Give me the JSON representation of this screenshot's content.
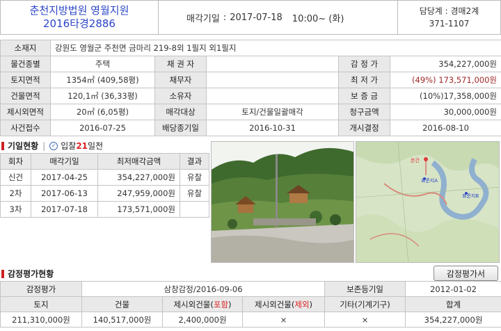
{
  "header": {
    "court": "춘천지방법원 영월지원",
    "case_no": "2016타경2886",
    "sale_date_label": "매각기일",
    "sale_date": "2017-07-18",
    "sale_time": "10:00~ (화)",
    "dept": "담당계 : 경매2계",
    "phone": "371-1107"
  },
  "property": {
    "address_label": "소재지",
    "address": "강원도 영월군 주천면 금마리 219-8외 1필지 외1필지",
    "type_label": "물건종별",
    "type": "주택",
    "creditor_label": "채 권 자",
    "creditor": "",
    "appraisal_label": "감 정 가",
    "appraisal": "354,227,000원",
    "land_label": "토지면적",
    "land": "1354㎡ (409,58평)",
    "debtor_label": "채무자",
    "debtor": "",
    "min_label": "최 저 가",
    "min_pct": "(49%)",
    "min_price": "173,571,000원",
    "bldg_label": "건물면적",
    "bldg": "120,1㎡ (36,33평)",
    "owner_label": "소유자",
    "owner": "",
    "deposit_label": "보 증 금",
    "deposit": "(10%)17,358,000원",
    "excl_label": "제시외면적",
    "excl": "20㎡ (6,05평)",
    "target_label": "매각대상",
    "target": "토지/건물일괄매각",
    "claim_label": "청구금액",
    "claim": "30,000,000원",
    "receipt_label": "사건접수",
    "receipt": "2016-07-25",
    "dist_label": "배당종기일",
    "dist": "2016-10-31",
    "start_label": "개시결정",
    "start": "2016-08-10"
  },
  "auction": {
    "title": "기일현황",
    "bid_prefix": "입찰",
    "bid_days": "21",
    "bid_suffix": "일전",
    "headers": [
      "회차",
      "매각기일",
      "최저매각금액",
      "결과"
    ],
    "rows": [
      {
        "round": "신건",
        "date": "2017-04-25",
        "price": "354,227,000원",
        "result": "유찰"
      },
      {
        "round": "2차",
        "date": "2017-06-13",
        "price": "247,959,000원",
        "result": "유찰"
      },
      {
        "round": "3차",
        "date": "2017-07-18",
        "price": "173,571,000원",
        "result": ""
      }
    ]
  },
  "map": {
    "label_main": "본건",
    "label_a": "표준지A",
    "label_b": "표준지B"
  },
  "appraisal": {
    "title": "감정평가현황",
    "button": "감정평가서",
    "agency_label": "감정평가",
    "agency": "삼창감정/2016-09-06",
    "preserve_label": "보존등기일",
    "preserve": "2012-01-02",
    "col_land": "토지",
    "col_bldg": "건물",
    "col_ex_in_a": "제시외건물(",
    "col_ex_in_b": "포함",
    "col_ex_out_a": "제시외건물(",
    "col_ex_out_b": "제외",
    "col_close": ")",
    "col_other": "기타(기계기구)",
    "col_total": "합계",
    "land": "211,310,000원",
    "bldg": "140,517,000원",
    "ex_in": "2,400,000원",
    "ex_out": "×",
    "other": "×",
    "total": "354,227,000원"
  },
  "colors": {
    "court_text": "#2a45c8",
    "accent_red": "#d22222",
    "label_bg": "#e9e9e9"
  }
}
